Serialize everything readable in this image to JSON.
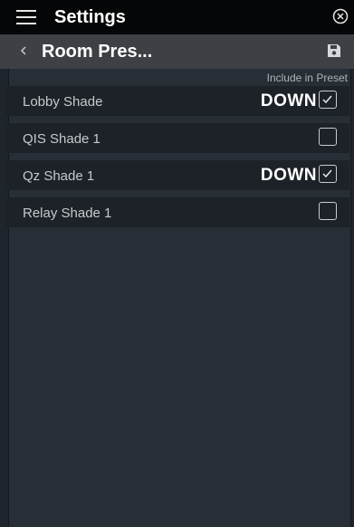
{
  "header": {
    "title": "Settings",
    "menu_icon": "hamburger-menu-icon",
    "close_icon": "close-circle-icon"
  },
  "subheader": {
    "title": "Room Pres...",
    "back_icon": "chevron-left-icon",
    "save_icon": "floppy-disk-save-icon"
  },
  "table": {
    "column_header": "Include in Preset",
    "rows": [
      {
        "label": "Lobby Shade",
        "state": "DOWN",
        "included": true
      },
      {
        "label": "QIS Shade 1",
        "state": "",
        "included": false
      },
      {
        "label": "Qz Shade 1",
        "state": "DOWN",
        "included": true
      },
      {
        "label": "Relay Shade 1",
        "state": "",
        "included": false
      }
    ]
  },
  "colors": {
    "topbar": "#050607",
    "subbar": "#3d4146",
    "panel": "#282e35",
    "row": "#1d2228"
  }
}
